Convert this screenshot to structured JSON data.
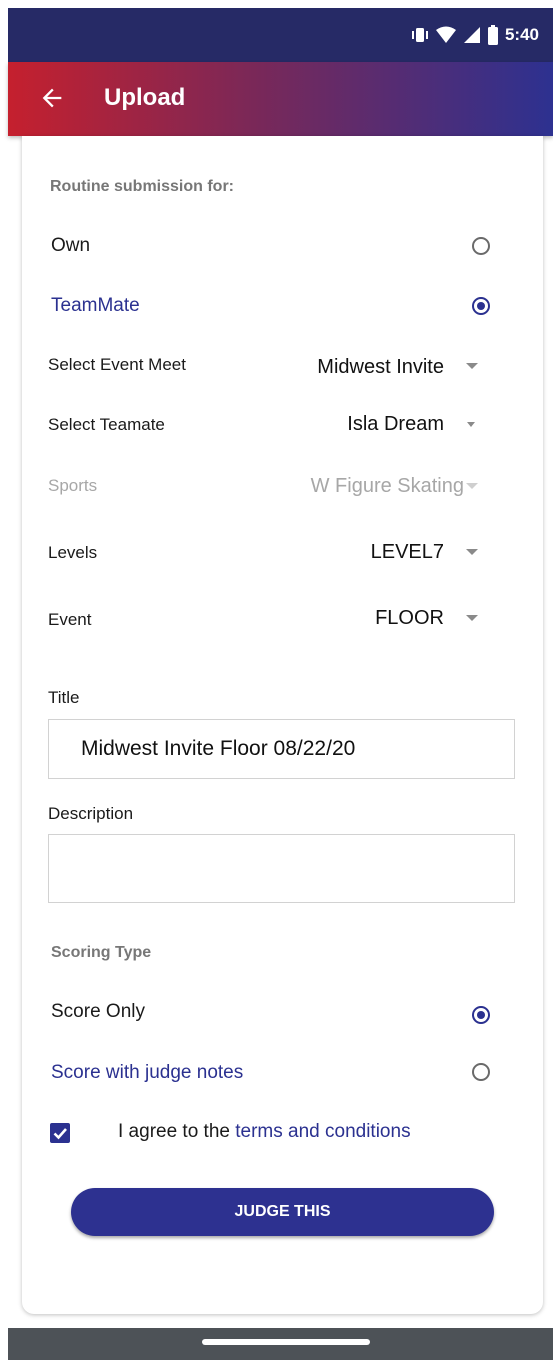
{
  "status_bar": {
    "time": "5:40",
    "icons": [
      "vibrate-icon",
      "wifi-icon",
      "signal-icon",
      "battery-icon"
    ]
  },
  "app_bar": {
    "title": "Upload",
    "back_icon": "arrow-left-icon"
  },
  "routine": {
    "heading": "Routine submission for:",
    "options": [
      {
        "label": "Own",
        "selected": false
      },
      {
        "label": "TeamMate",
        "selected": true
      }
    ]
  },
  "fields": {
    "event_meet": {
      "label": "Select Event Meet",
      "value": "Midwest Invite"
    },
    "teammate": {
      "label": "Select Teamate",
      "value": "Isla Dream"
    },
    "sports": {
      "label": "Sports",
      "value": "W Figure Skating",
      "disabled": true
    },
    "levels": {
      "label": "Levels",
      "value": "LEVEL7"
    },
    "event": {
      "label": "Event",
      "value": "FLOOR"
    }
  },
  "title_field": {
    "label": "Title",
    "value": "Midwest Invite Floor 08/22/20"
  },
  "description_field": {
    "label": "Description",
    "value": ""
  },
  "scoring": {
    "heading": "Scoring Type",
    "options": [
      {
        "label": "Score Only",
        "selected": true
      },
      {
        "label": "Score with judge notes",
        "selected": false
      }
    ]
  },
  "agreement": {
    "checked": true,
    "prefix": "I agree to the",
    "link": "terms and conditions"
  },
  "submit": {
    "label": "JUDGE THIS"
  },
  "colors": {
    "accent": "#2b3190",
    "appbar_start": "#c5202e",
    "appbar_end": "#2d3190",
    "statusbar": "#262a66"
  }
}
